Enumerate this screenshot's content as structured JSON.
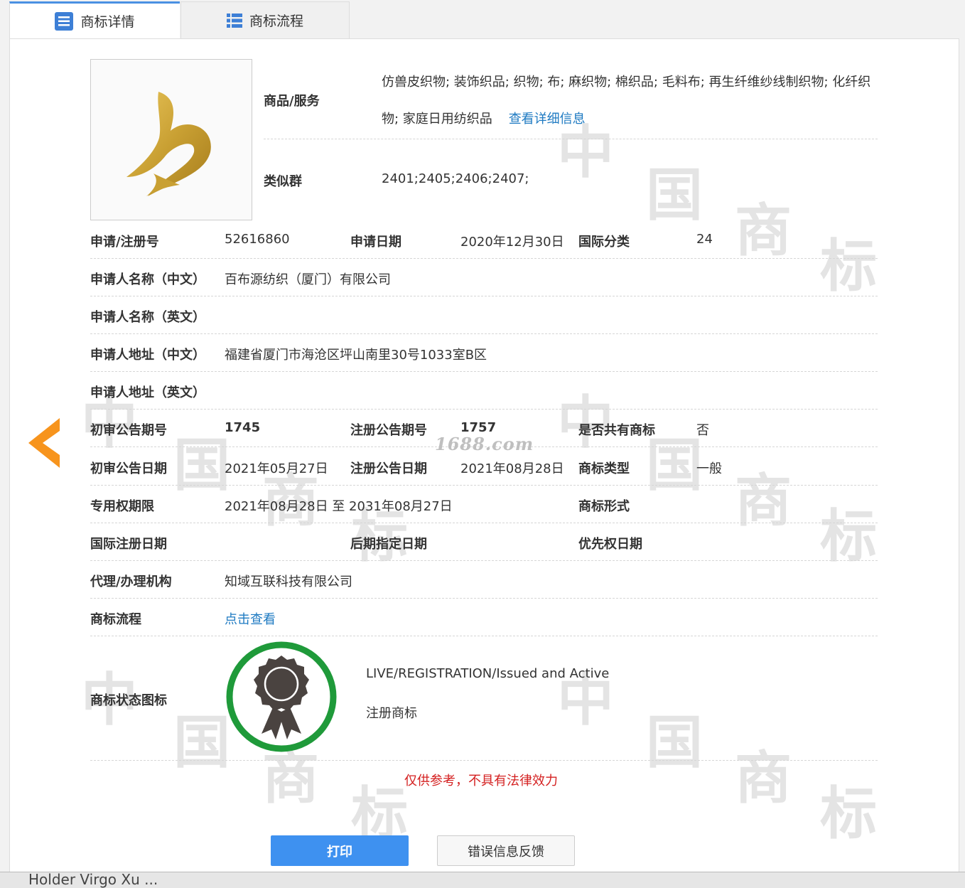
{
  "tabs": {
    "detail": "商标详情",
    "flow": "商标流程"
  },
  "goods": {
    "label": "商品/服务",
    "line1": "仿兽皮织物; 装饰织品; 织物; 布; 麻织物; 棉织品; 毛料布; 再生纤维纱线制织物; 化纤织",
    "line2": "物; 家庭日用纺织品",
    "detail_link": "查看详细信息"
  },
  "similar": {
    "label": "类似群",
    "value": "2401;2405;2406;2407;"
  },
  "app_no": {
    "label": "申请/注册号",
    "value": "52616860"
  },
  "app_date": {
    "label": "申请日期",
    "value": "2020年12月30日"
  },
  "intl_class": {
    "label": "国际分类",
    "value": "24"
  },
  "applicant_cn": {
    "label": "申请人名称（中文）",
    "value": "百布源纺织（厦门）有限公司"
  },
  "applicant_en": {
    "label": "申请人名称（英文）",
    "value": ""
  },
  "address_cn": {
    "label": "申请人地址（中文）",
    "value": "福建省厦门市海沧区坪山南里30号1033室B区"
  },
  "address_en": {
    "label": "申请人地址（英文）",
    "value": ""
  },
  "prelim_no": {
    "label": "初审公告期号",
    "value": "1745"
  },
  "reg_no": {
    "label": "注册公告期号",
    "value": "1757"
  },
  "shared": {
    "label": "是否共有商标",
    "value": "否"
  },
  "prelim_date": {
    "label": "初审公告日期",
    "value": "2021年05月27日"
  },
  "reg_date": {
    "label": "注册公告日期",
    "value": "2021年08月28日"
  },
  "tm_type": {
    "label": "商标类型",
    "value": "一般"
  },
  "term": {
    "label": "专用权期限",
    "value": "2021年08月28日 至 2031年08月27日"
  },
  "tm_form": {
    "label": "商标形式",
    "value": ""
  },
  "intl_reg_date": {
    "label": "国际注册日期",
    "value": ""
  },
  "later_date": {
    "label": "后期指定日期",
    "value": ""
  },
  "priority_date": {
    "label": "优先权日期",
    "value": ""
  },
  "agent": {
    "label": "代理/办理机构",
    "value": "知域互联科技有限公司"
  },
  "flow": {
    "label": "商标流程",
    "link": "点击查看"
  },
  "status": {
    "label": "商标状态图标",
    "en": "LIVE/REGISTRATION/Issued and Active",
    "cn": "注册商标"
  },
  "disclaimer": "仅供参考，不具有法律效力",
  "buttons": {
    "print": "打印",
    "feedback": "错误信息反馈"
  },
  "watermark_site": "1688.com",
  "bottom_text": "Holder Virgo Xu ...",
  "colors": {
    "accent": "#3e91f0",
    "link": "#1e7ac2",
    "disclaimer": "#d42020",
    "status_ring": "#1f9a3a",
    "arrow": "#f7941d"
  }
}
